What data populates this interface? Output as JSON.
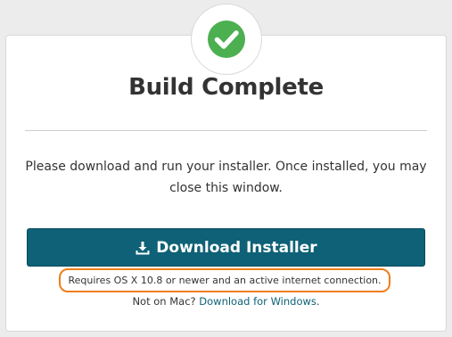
{
  "header": {
    "title": "Build Complete",
    "status_icon": "check-circle-icon",
    "status_color": "#4caf50"
  },
  "body": {
    "message": "Please download and run your installer. Once installed, you may close this window."
  },
  "download": {
    "label": "Download Installer",
    "icon": "download-icon",
    "color": "#0e6176"
  },
  "requirements": {
    "text": "Requires OS X 10.8 or newer and an active internet connection.",
    "highlight_color": "#f07d1a"
  },
  "alternate": {
    "prefix": "Not on Mac?",
    "link_label": "Download for Windows",
    "suffix": "."
  }
}
